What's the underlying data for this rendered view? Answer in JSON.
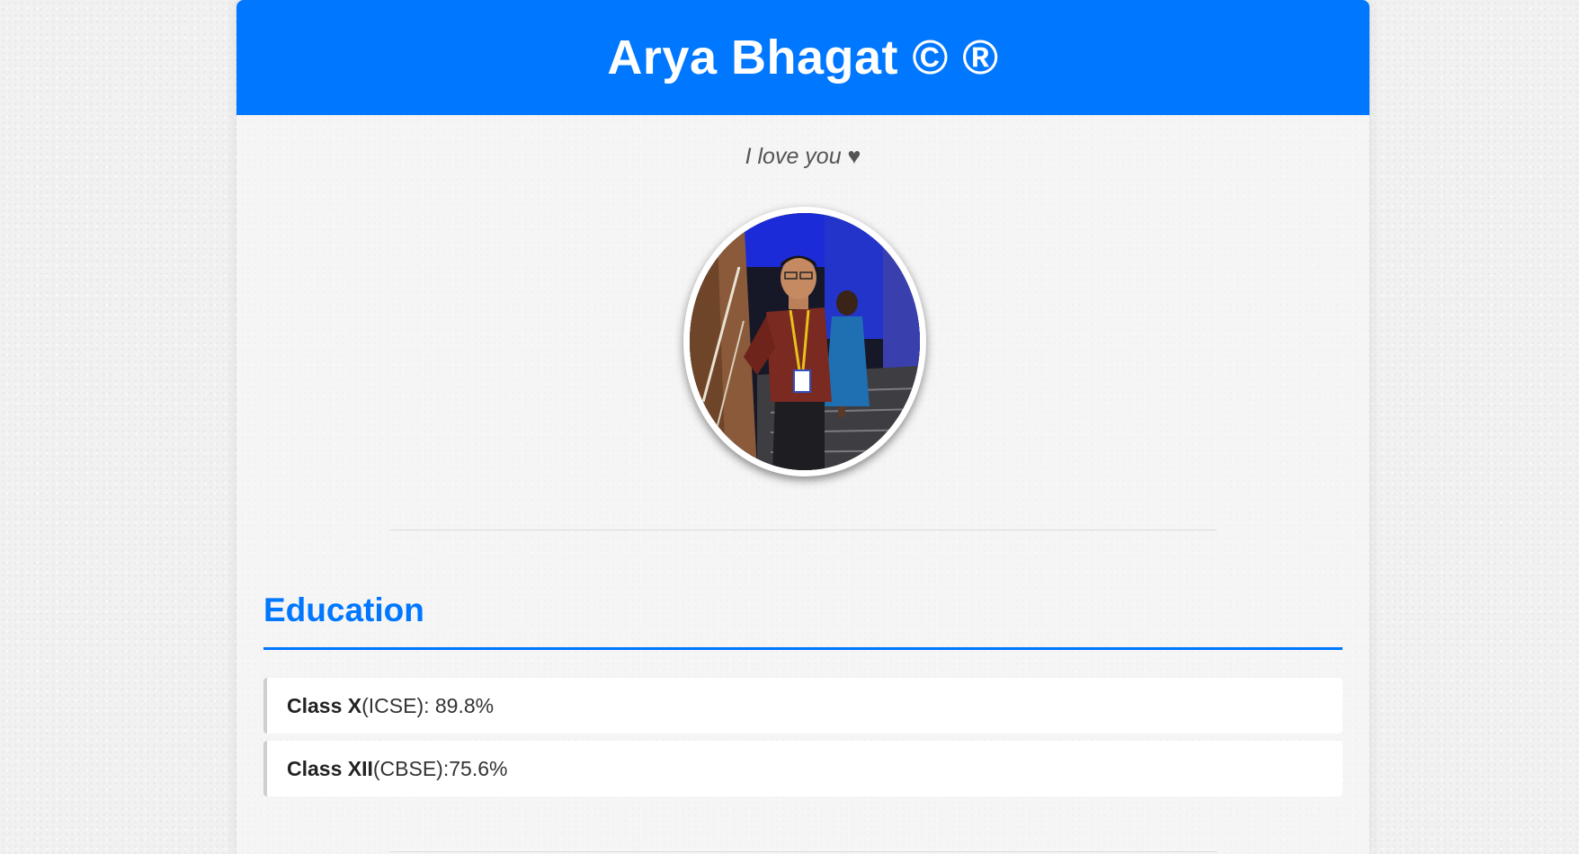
{
  "header": {
    "title": "Arya Bhagat © ®"
  },
  "profile": {
    "tagline": "I love you ♥",
    "photo_alt": "avatar-photo"
  },
  "education": {
    "heading": "Education",
    "items": [
      {
        "label": "Class X",
        "detail": "(ICSE): 89.8%"
      },
      {
        "label": "Class XII",
        "detail": "(CBSE):75.6%"
      }
    ]
  },
  "colors": {
    "accent": "#0077ff",
    "background": "#f1f1f1",
    "text": "#333333"
  }
}
